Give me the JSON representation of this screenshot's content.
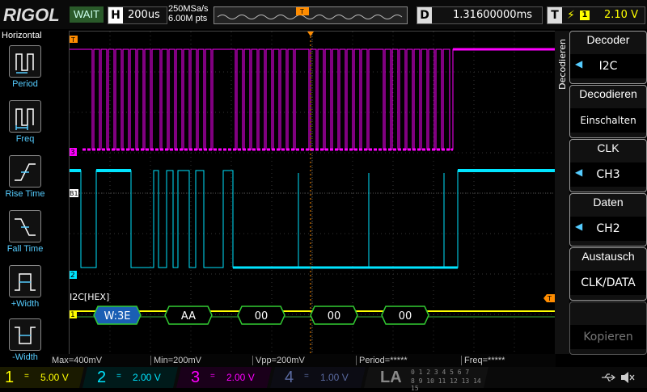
{
  "topbar": {
    "logo": "RIGOL",
    "status": "WAIT",
    "hscale_key": "H",
    "hscale_value": "200us",
    "sample_rate": "250MSa/s",
    "mem_depth": "6.00M pts",
    "delay_key": "D",
    "delay_value": "1.31600000ms",
    "trigger_key": "T",
    "trigger_edge": "⚡",
    "trigger_channel": "1",
    "trigger_level": "2.10 V"
  },
  "leftpanel": {
    "title": "Horizontal",
    "items": [
      {
        "label": "Period",
        "icon": "period-icon"
      },
      {
        "label": "Freq",
        "icon": "freq-icon"
      },
      {
        "label": "Rise Time",
        "icon": "rise-time-icon"
      },
      {
        "label": "Fall Time",
        "icon": "fall-time-icon"
      },
      {
        "label": "+Width",
        "icon": "plus-width-icon"
      },
      {
        "label": "-Width",
        "icon": "minus-width-icon"
      }
    ]
  },
  "display": {
    "decode_label": "I2C[HEX]",
    "packets": [
      "W:3E",
      "AA",
      "00",
      "00",
      "00"
    ],
    "markers": {
      "ch3": "3",
      "ch2": "2",
      "ch1": "1",
      "trigger": "T",
      "b1": "B1"
    }
  },
  "measurements": {
    "max": "Max=400mV",
    "min": "Min=200mV",
    "vpp": "Vpp=200mV",
    "period": "Period=*****",
    "freq": "Freq=*****"
  },
  "channels": [
    {
      "num": "1",
      "coupling": "=",
      "scale": "5.00 V",
      "color": "#ffff00"
    },
    {
      "num": "2",
      "coupling": "=",
      "scale": "2.00 V",
      "color": "#00e5ff"
    },
    {
      "num": "3",
      "coupling": "=",
      "scale": "2.00 V",
      "color": "#ff00ff"
    },
    {
      "num": "4",
      "coupling": "=",
      "scale": "1.00 V",
      "color": "#5a6aa0"
    }
  ],
  "la": {
    "label": "LA",
    "bits_top": "0 1 2 3   4 5 6 7",
    "bits_bottom": "8 9 10 11   12 13 14 15"
  },
  "rightpanel": {
    "tab_label": "Decodieren",
    "buttons": [
      {
        "title": "Decoder",
        "value": "I2C"
      },
      {
        "title": "Decodieren",
        "value": "Einschalten"
      },
      {
        "title": "CLK",
        "value": "CH3"
      },
      {
        "title": "Daten",
        "value": "CH2"
      },
      {
        "title": "Austausch",
        "value": "CLK/DATA"
      },
      {
        "title": "",
        "value": "Kopieren"
      }
    ]
  },
  "colors": {
    "ch1": "#ffff00",
    "ch2": "#00e5ff",
    "ch3": "#ff00ff",
    "trigger": "#ff8c00",
    "packet_border": "#33cc33",
    "address_fill": "#1a5fb4"
  }
}
